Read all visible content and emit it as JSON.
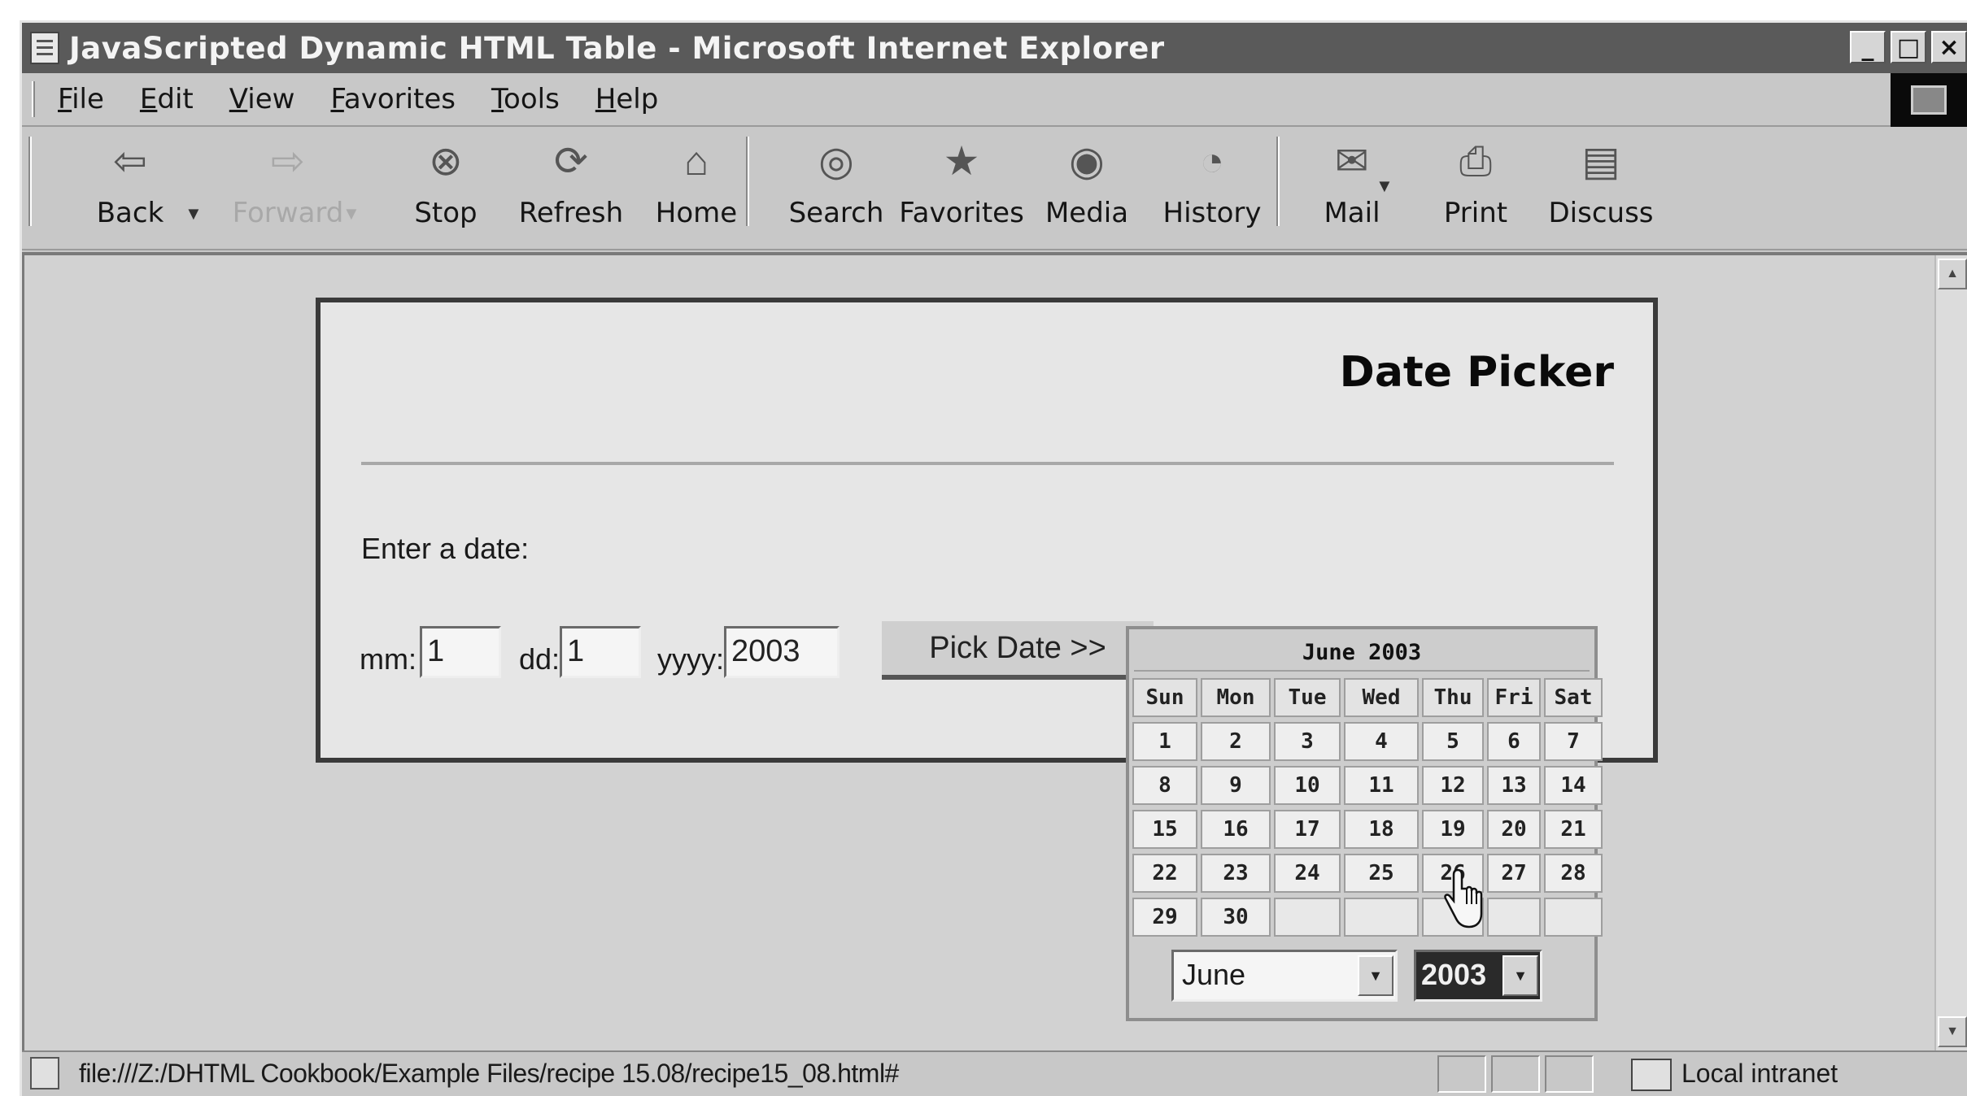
{
  "window": {
    "title": "JavaScripted Dynamic HTML Table - Microsoft Internet Explorer",
    "minimize_glyph": "_",
    "maximize_glyph": "□",
    "close_glyph": "×"
  },
  "menu": {
    "items": [
      "File",
      "Edit",
      "View",
      "Favorites",
      "Tools",
      "Help"
    ]
  },
  "toolbar": {
    "buttons": [
      {
        "label": "Back",
        "icon": "back-arrow-icon",
        "enabled": true
      },
      {
        "label": "Forward",
        "icon": "forward-arrow-icon",
        "enabled": false
      },
      {
        "label": "Stop",
        "icon": "stop-icon",
        "enabled": true
      },
      {
        "label": "Refresh",
        "icon": "refresh-icon",
        "enabled": true
      },
      {
        "label": "Home",
        "icon": "home-icon",
        "enabled": true
      },
      {
        "label": "Search",
        "icon": "search-icon",
        "enabled": true
      },
      {
        "label": "Favorites",
        "icon": "favorites-icon",
        "enabled": true
      },
      {
        "label": "Media",
        "icon": "media-icon",
        "enabled": true
      },
      {
        "label": "History",
        "icon": "history-icon",
        "enabled": true
      },
      {
        "label": "Mail",
        "icon": "mail-icon",
        "enabled": true
      },
      {
        "label": "Print",
        "icon": "print-icon",
        "enabled": true
      },
      {
        "label": "Discuss",
        "icon": "discuss-icon",
        "enabled": true
      }
    ]
  },
  "page": {
    "heading": "Date Picker",
    "prompt": "Enter a date:",
    "fields": {
      "mm_label": "mm:",
      "mm_value": "1",
      "dd_label": "dd:",
      "dd_value": "1",
      "yyyy_label": "yyyy:",
      "yyyy_value": "2003"
    },
    "pick_button": "Pick Date >>"
  },
  "calendar": {
    "title": "June 2003",
    "weekdays": [
      "Sun",
      "Mon",
      "Tue",
      "Wed",
      "Thu",
      "Fri",
      "Sat"
    ],
    "weeks": [
      [
        "1",
        "2",
        "3",
        "4",
        "5",
        "6",
        "7"
      ],
      [
        "8",
        "9",
        "10",
        "11",
        "12",
        "13",
        "14"
      ],
      [
        "15",
        "16",
        "17",
        "18",
        "19",
        "20",
        "21"
      ],
      [
        "22",
        "23",
        "24",
        "25",
        "26",
        "27",
        "28"
      ],
      [
        "29",
        "30",
        "",
        "",
        "",
        "",
        ""
      ]
    ],
    "month_select": "June",
    "year_select": "2003"
  },
  "statusbar": {
    "url": "file:///Z:/DHTML Cookbook/Example Files/recipe 15.08/recipe15_08.html#",
    "zone": "Local intranet"
  }
}
